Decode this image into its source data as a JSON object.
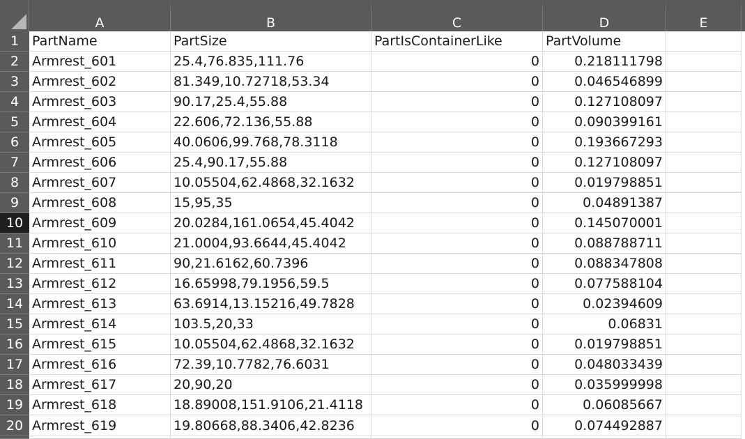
{
  "sheet": {
    "columns": [
      "A",
      "B",
      "C",
      "D",
      "E"
    ],
    "header_row_number": "1",
    "headers": [
      "PartName",
      "PartSize",
      "PartIsContainerLike",
      "PartVolume",
      ""
    ],
    "selected_row": "10",
    "rows": [
      {
        "n": "2",
        "name": "Armrest_601",
        "size": "25.4,76.835,111.76",
        "container": "0",
        "volume": "0.218111798"
      },
      {
        "n": "3",
        "name": "Armrest_602",
        "size": "81.349,10.72718,53.34",
        "container": "0",
        "volume": "0.046546899"
      },
      {
        "n": "4",
        "name": "Armrest_603",
        "size": "90.17,25.4,55.88",
        "container": "0",
        "volume": "0.127108097"
      },
      {
        "n": "5",
        "name": "Armrest_604",
        "size": "22.606,72.136,55.88",
        "container": "0",
        "volume": "0.090399161"
      },
      {
        "n": "6",
        "name": "Armrest_605",
        "size": "40.0606,99.768,78.3118",
        "container": "0",
        "volume": "0.193667293"
      },
      {
        "n": "7",
        "name": "Armrest_606",
        "size": "25.4,90.17,55.88",
        "container": "0",
        "volume": "0.127108097"
      },
      {
        "n": "8",
        "name": "Armrest_607",
        "size": "10.05504,62.4868,32.1632",
        "container": "0",
        "volume": "0.019798851"
      },
      {
        "n": "9",
        "name": "Armrest_608",
        "size": "15,95,35",
        "container": "0",
        "volume": "0.04891387"
      },
      {
        "n": "10",
        "name": "Armrest_609",
        "size": "20.0284,161.0654,45.4042",
        "container": "0",
        "volume": "0.145070001"
      },
      {
        "n": "11",
        "name": "Armrest_610",
        "size": "21.0004,93.6644,45.4042",
        "container": "0",
        "volume": "0.088788711"
      },
      {
        "n": "12",
        "name": "Armrest_611",
        "size": "90,21.6162,60.7396",
        "container": "0",
        "volume": "0.088347808"
      },
      {
        "n": "13",
        "name": "Armrest_612",
        "size": "16.65998,79.1956,59.5",
        "container": "0",
        "volume": "0.077588104"
      },
      {
        "n": "14",
        "name": "Armrest_613",
        "size": "63.6914,13.15216,49.7828",
        "container": "0",
        "volume": "0.02394609"
      },
      {
        "n": "15",
        "name": "Armrest_614",
        "size": "103.5,20,33",
        "container": "0",
        "volume": "0.06831"
      },
      {
        "n": "16",
        "name": "Armrest_615",
        "size": "10.05504,62.4868,32.1632",
        "container": "0",
        "volume": "0.019798851"
      },
      {
        "n": "17",
        "name": "Armrest_616",
        "size": "72.39,10.7782,76.6031",
        "container": "0",
        "volume": "0.048033439"
      },
      {
        "n": "18",
        "name": "Armrest_617",
        "size": "20,90,20",
        "container": "0",
        "volume": "0.035999998"
      },
      {
        "n": "19",
        "name": "Armrest_618",
        "size": "18.89008,151.9106,21.4118",
        "container": "0",
        "volume": "0.06085667"
      },
      {
        "n": "20",
        "name": "Armrest_619",
        "size": "19.80668,88.3406,42.8236",
        "container": "0",
        "volume": "0.074492887"
      }
    ]
  },
  "colors": {
    "header_bg": "#5a5a5a",
    "header_text": "#ffffff",
    "selected_row_header_bg": "#1f1f1f",
    "gridline": "#dadada"
  }
}
